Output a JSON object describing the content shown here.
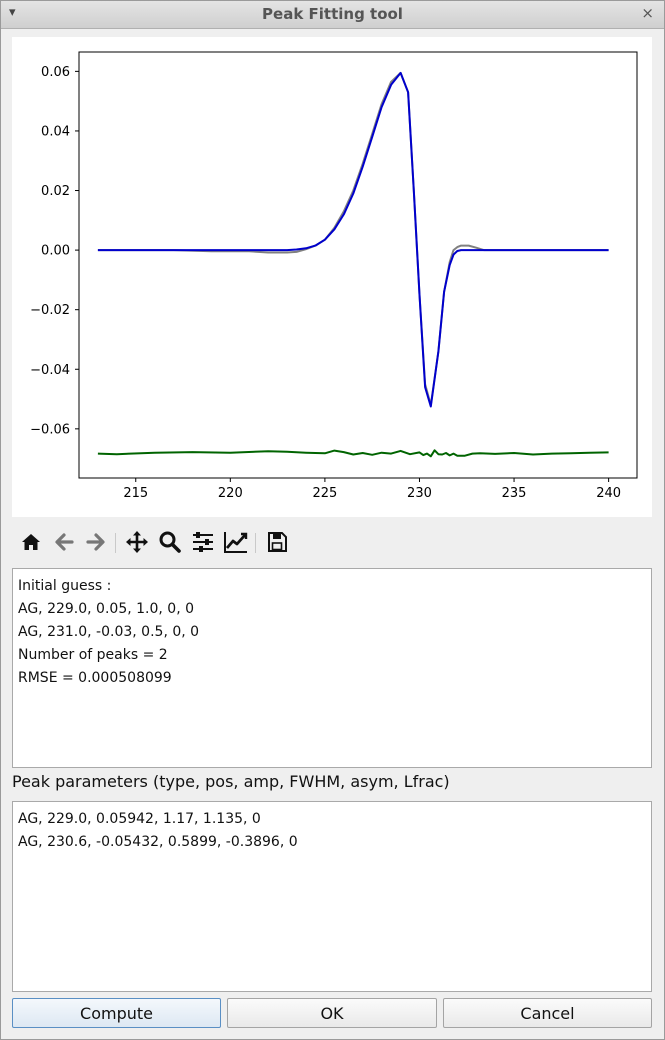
{
  "window": {
    "title": "Peak Fitting tool",
    "menu_glyph": "▾",
    "close_glyph": "×"
  },
  "chart_data": {
    "type": "line",
    "xlim": [
      212,
      241.5
    ],
    "ylim": [
      -0.0765,
      0.0665
    ],
    "xticks": [
      215,
      220,
      225,
      230,
      235,
      240
    ],
    "yticks": [
      0.06,
      0.04,
      0.02,
      0.0,
      -0.02,
      -0.04,
      -0.06
    ],
    "ytick_labels": [
      "0.06",
      "0.04",
      "0.02",
      "0.00",
      "−0.02",
      "−0.04",
      "−0.06"
    ],
    "grid": false,
    "legend": "none",
    "series": [
      {
        "color": "#808080",
        "x": [
          213,
          215,
          217,
          219,
          221,
          222,
          223,
          223.5,
          224,
          224.5,
          225,
          225.5,
          226,
          226.5,
          227,
          227.5,
          228,
          228.5,
          229,
          229.4,
          229.7,
          230,
          230.3,
          230.6,
          231,
          231.3,
          231.6,
          231.8,
          232,
          232.2,
          232.6,
          233,
          233.4,
          234,
          236,
          238,
          240
        ],
        "y": [
          0,
          0,
          0,
          -0.0004,
          -0.0004,
          -0.0008,
          -0.0008,
          -0.0006,
          0.0003,
          0.0015,
          0.0035,
          0.0075,
          0.013,
          0.02,
          0.029,
          0.039,
          0.049,
          0.0565,
          0.0595,
          0.053,
          0.02,
          -0.015,
          -0.045,
          -0.052,
          -0.034,
          -0.014,
          -0.004,
          0,
          0.001,
          0.0015,
          0.0015,
          0.0008,
          0,
          0,
          0,
          0,
          0
        ]
      },
      {
        "color": "#0000cc",
        "x": [
          213,
          215,
          217,
          219,
          221,
          222,
          223,
          223.5,
          224,
          224.5,
          225,
          225.5,
          226,
          226.5,
          227,
          227.5,
          228,
          228.5,
          229,
          229.4,
          229.7,
          230,
          230.3,
          230.6,
          231,
          231.3,
          231.6,
          231.8,
          232,
          232.2,
          232.6,
          233,
          233.4,
          234,
          236,
          238,
          240
        ],
        "y": [
          0,
          0,
          0,
          0,
          0,
          0,
          0,
          0.0002,
          0.0006,
          0.0015,
          0.0035,
          0.007,
          0.012,
          0.019,
          0.028,
          0.038,
          0.048,
          0.0555,
          0.0595,
          0.053,
          0.02,
          -0.015,
          -0.046,
          -0.0525,
          -0.034,
          -0.014,
          -0.005,
          -0.0015,
          -0.0003,
          0,
          0,
          0,
          0,
          0,
          0,
          0,
          0
        ]
      },
      {
        "color": "#006400",
        "x": [
          213,
          214,
          216,
          218,
          220,
          222,
          223,
          224,
          225,
          225.5,
          226,
          226.5,
          227,
          227.5,
          228,
          228.5,
          229,
          229.5,
          230,
          230.2,
          230.4,
          230.6,
          230.8,
          231,
          231.2,
          231.4,
          231.6,
          231.8,
          232,
          232.4,
          232.8,
          233.2,
          234,
          235,
          236,
          237,
          238,
          239,
          240
        ],
        "y": [
          -0.0683,
          -0.0685,
          -0.068,
          -0.0678,
          -0.068,
          -0.0675,
          -0.0677,
          -0.068,
          -0.0682,
          -0.0673,
          -0.0678,
          -0.0686,
          -0.0681,
          -0.0687,
          -0.068,
          -0.0683,
          -0.0674,
          -0.0685,
          -0.0679,
          -0.0688,
          -0.0683,
          -0.0692,
          -0.0672,
          -0.0685,
          -0.0686,
          -0.0681,
          -0.0689,
          -0.0683,
          -0.069,
          -0.069,
          -0.0683,
          -0.0682,
          -0.0684,
          -0.0681,
          -0.0686,
          -0.0683,
          -0.0682,
          -0.068,
          -0.0679
        ]
      }
    ]
  },
  "toolbar": [
    {
      "name": "home-icon"
    },
    {
      "name": "back-arrow-icon"
    },
    {
      "name": "forward-arrow-icon"
    },
    {
      "name": "pan-move-icon"
    },
    {
      "name": "zoom-magnifier-icon"
    },
    {
      "name": "subplot-sliders-icon"
    },
    {
      "name": "edit-axis-icon"
    },
    {
      "name": "save-floppy-icon"
    }
  ],
  "log": {
    "lines": [
      "Initial guess :",
      "AG, 229.0, 0.05, 1.0, 0, 0",
      "AG, 231.0, -0.03, 0.5, 0, 0",
      "Number of peaks = 2",
      "RMSE = 0.000508099"
    ]
  },
  "params_label": "Peak parameters (type, pos, amp, FWHM, asym, Lfrac)",
  "params": {
    "lines": [
      "AG, 229.0, 0.05942, 1.17, 1.135, 0",
      "AG, 230.6, -0.05432, 0.5899, -0.3896, 0"
    ]
  },
  "buttons": {
    "compute": "Compute",
    "ok": "OK",
    "cancel": "Cancel"
  }
}
